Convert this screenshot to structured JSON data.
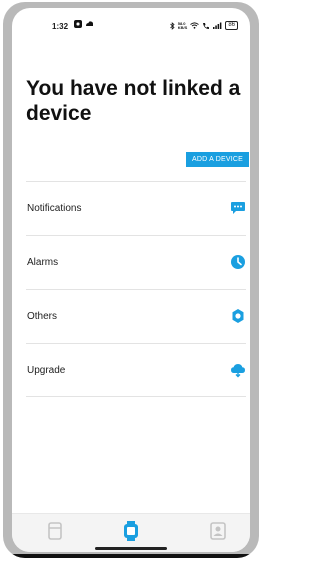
{
  "status_bar": {
    "time": "1:32",
    "network_speed": "58.0\nKB/S",
    "battery": "86"
  },
  "page": {
    "title": "You have not linked a device",
    "add_device_label": "ADD A DEVICE"
  },
  "menu": {
    "items": [
      {
        "label": "Notifications",
        "icon": "chat-bubble-icon"
      },
      {
        "label": "Alarms",
        "icon": "clock-icon"
      },
      {
        "label": "Others",
        "icon": "gear-icon"
      },
      {
        "label": "Upgrade",
        "icon": "cloud-download-icon"
      }
    ]
  },
  "bottom_nav": {
    "items": [
      {
        "icon": "card-icon",
        "active": false
      },
      {
        "icon": "watch-icon",
        "active": true
      },
      {
        "icon": "profile-icon",
        "active": false
      }
    ]
  },
  "colors": {
    "accent": "#1a9fe0",
    "inactive_icon": "#c4c4c4",
    "frame": "#b9b9b9"
  }
}
